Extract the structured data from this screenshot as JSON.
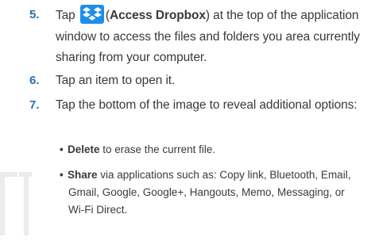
{
  "steps": [
    {
      "num": "5.",
      "pre": "Tap",
      "icon": "dropbox-icon",
      "paren_open": "(",
      "bold": "Access Dropbox",
      "paren_close": ")",
      "rest": " at the top of the application window to access the files and folders you area currently sharing from your computer."
    },
    {
      "num": "6.",
      "text": "Tap an item to open it."
    },
    {
      "num": "7.",
      "text": "Tap the bottom of the image to reveal additional options:"
    }
  ],
  "bullets": [
    {
      "dot": "•",
      "bold": "Delete",
      "text": " to erase the current file."
    },
    {
      "dot": "•",
      "bold": "Share",
      "text": " via applications such as: Copy link, Bluetooth, Email,",
      "line2": "Gmail, Google, Google+, Hangouts, Memo, Messaging, or",
      "line3": "Wi-Fi Direct."
    }
  ],
  "colors": {
    "step_number": "#2c6cb3",
    "text": "#3a3a3a",
    "dropbox_blue": "#1e8ee8",
    "watermark": "#ececec"
  }
}
